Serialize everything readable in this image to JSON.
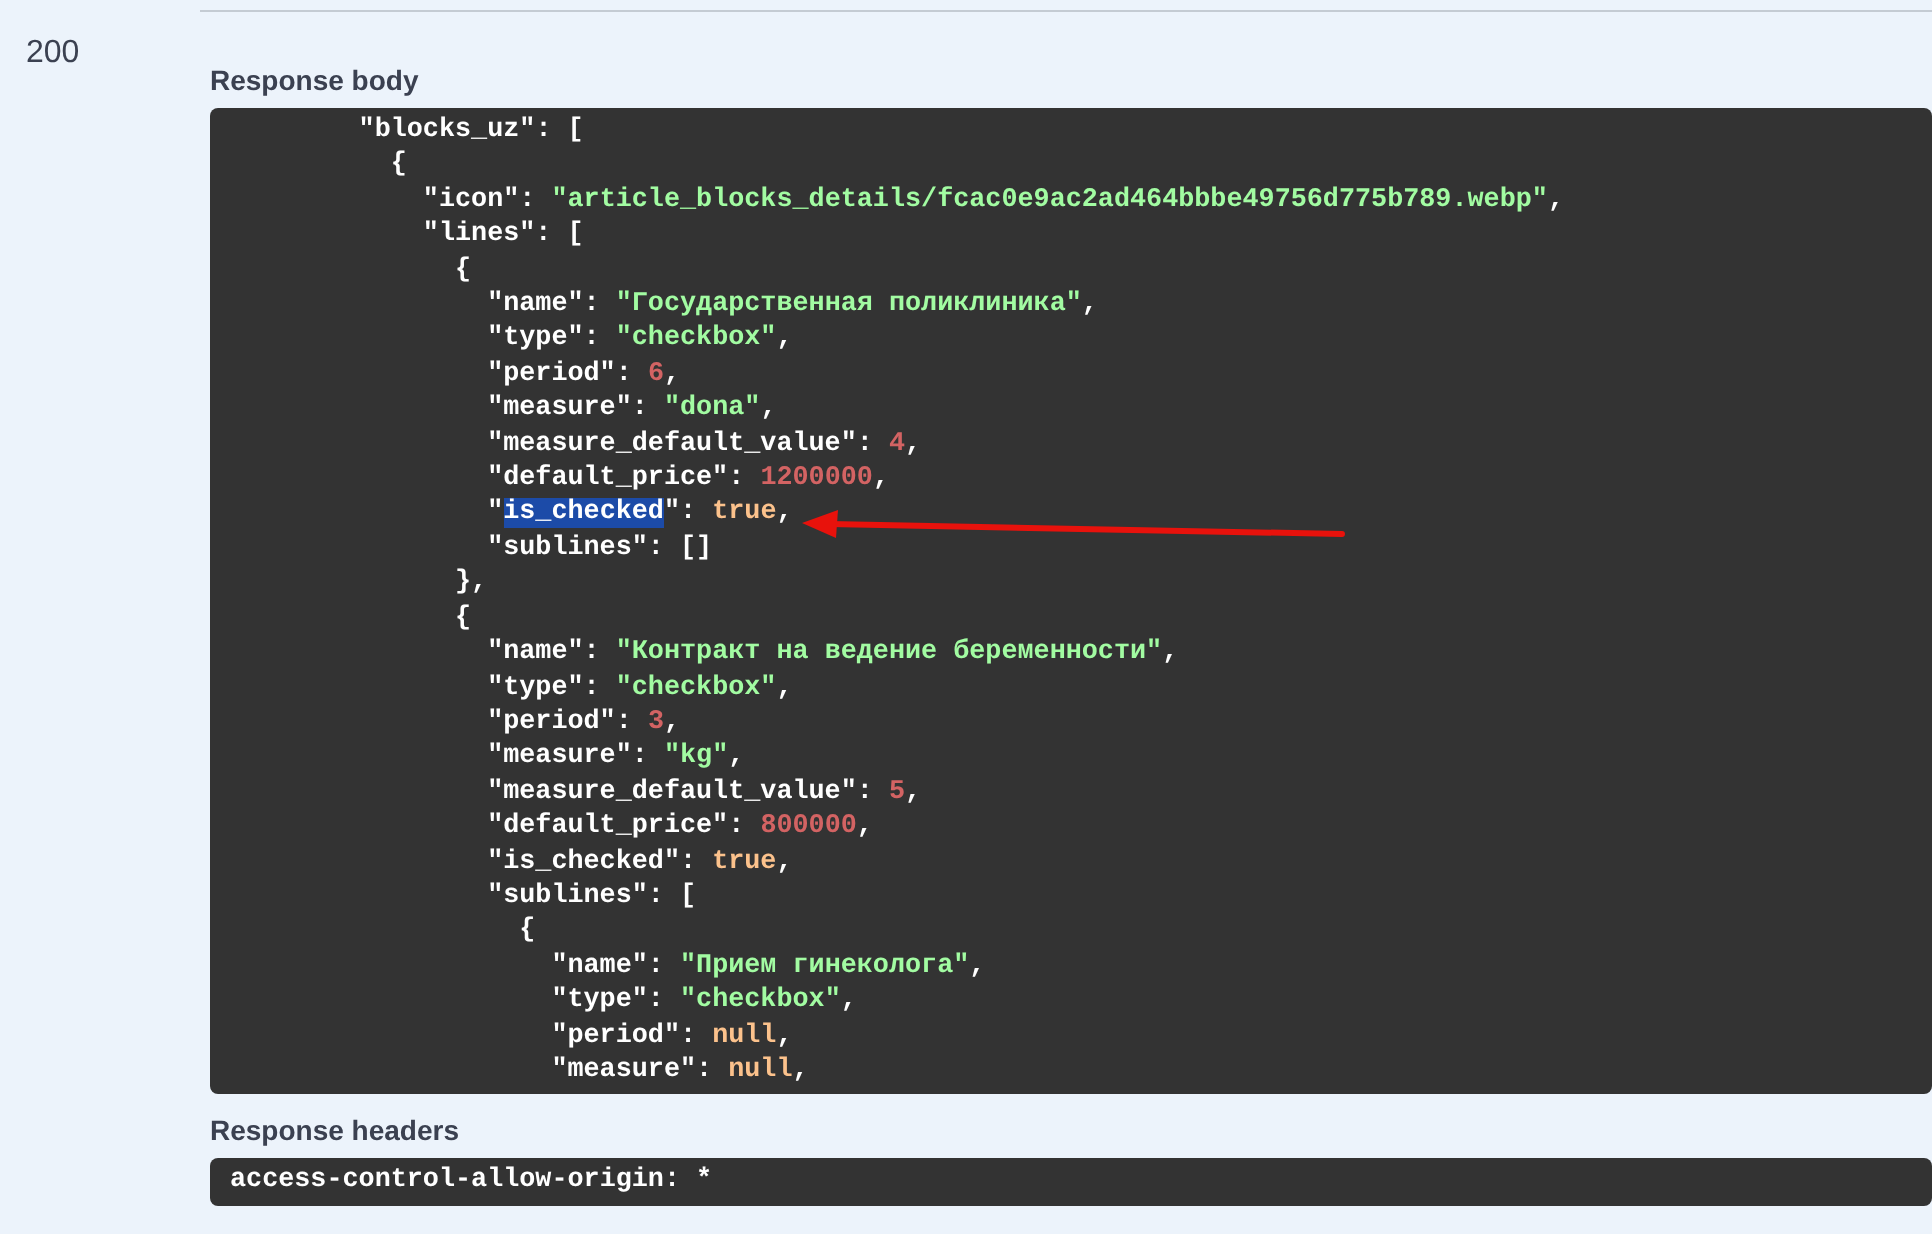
{
  "status_code": "200",
  "response_body": {
    "label": "Response body",
    "lines": [
      {
        "tokens": [
          {
            "kind": "k",
            "text": "\"blocks_uz\""
          },
          {
            "kind": "p",
            "text": ": ["
          }
        ]
      },
      {
        "tokens": [
          {
            "kind": "p",
            "text": "{"
          }
        ]
      },
      {
        "tokens": [
          {
            "kind": "k",
            "text": "\"icon\""
          },
          {
            "kind": "p",
            "text": ": "
          },
          {
            "kind": "s",
            "text": "\"article_blocks_details/fcac0e9ac2ad464bbbe49756d775b789.webp\""
          },
          {
            "kind": "p",
            "text": ","
          }
        ]
      },
      {
        "tokens": [
          {
            "kind": "k",
            "text": "\"lines\""
          },
          {
            "kind": "p",
            "text": ": ["
          }
        ]
      },
      {
        "tokens": [
          {
            "kind": "p",
            "text": "{"
          }
        ]
      },
      {
        "tokens": [
          {
            "kind": "k",
            "text": "\"name\""
          },
          {
            "kind": "p",
            "text": ": "
          },
          {
            "kind": "s",
            "text": "\"Государственная поликлиника\""
          },
          {
            "kind": "p",
            "text": ","
          }
        ]
      },
      {
        "tokens": [
          {
            "kind": "k",
            "text": "\"type\""
          },
          {
            "kind": "p",
            "text": ": "
          },
          {
            "kind": "s",
            "text": "\"checkbox\""
          },
          {
            "kind": "p",
            "text": ","
          }
        ]
      },
      {
        "tokens": [
          {
            "kind": "k",
            "text": "\"period\""
          },
          {
            "kind": "p",
            "text": ": "
          },
          {
            "kind": "n",
            "text": "6"
          },
          {
            "kind": "p",
            "text": ","
          }
        ]
      },
      {
        "tokens": [
          {
            "kind": "k",
            "text": "\"measure\""
          },
          {
            "kind": "p",
            "text": ": "
          },
          {
            "kind": "s",
            "text": "\"dona\""
          },
          {
            "kind": "p",
            "text": ","
          }
        ]
      },
      {
        "tokens": [
          {
            "kind": "k",
            "text": "\"measure_default_value\""
          },
          {
            "kind": "p",
            "text": ": "
          },
          {
            "kind": "n",
            "text": "4"
          },
          {
            "kind": "p",
            "text": ","
          }
        ]
      },
      {
        "tokens": [
          {
            "kind": "k",
            "text": "\"default_price\""
          },
          {
            "kind": "p",
            "text": ": "
          },
          {
            "kind": "n",
            "text": "1200000"
          },
          {
            "kind": "p",
            "text": ","
          }
        ]
      },
      {
        "tokens": [
          {
            "kind": "k",
            "text": "\""
          },
          {
            "kind": "sel",
            "text": "is_checked"
          },
          {
            "kind": "k",
            "text": "\""
          },
          {
            "kind": "p",
            "text": ": "
          },
          {
            "kind": "l",
            "text": "true"
          },
          {
            "kind": "p",
            "text": ","
          }
        ]
      },
      {
        "tokens": [
          {
            "kind": "k",
            "text": "\"sublines\""
          },
          {
            "kind": "p",
            "text": ": []"
          }
        ]
      },
      {
        "tokens": [
          {
            "kind": "p",
            "text": "},"
          }
        ]
      },
      {
        "tokens": [
          {
            "kind": "p",
            "text": "{"
          }
        ]
      },
      {
        "tokens": [
          {
            "kind": "k",
            "text": "\"name\""
          },
          {
            "kind": "p",
            "text": ": "
          },
          {
            "kind": "s",
            "text": "\"Контракт на ведение беременности\""
          },
          {
            "kind": "p",
            "text": ","
          }
        ]
      },
      {
        "tokens": [
          {
            "kind": "k",
            "text": "\"type\""
          },
          {
            "kind": "p",
            "text": ": "
          },
          {
            "kind": "s",
            "text": "\"checkbox\""
          },
          {
            "kind": "p",
            "text": ","
          }
        ]
      },
      {
        "tokens": [
          {
            "kind": "k",
            "text": "\"period\""
          },
          {
            "kind": "p",
            "text": ": "
          },
          {
            "kind": "n",
            "text": "3"
          },
          {
            "kind": "p",
            "text": ","
          }
        ]
      },
      {
        "tokens": [
          {
            "kind": "k",
            "text": "\"measure\""
          },
          {
            "kind": "p",
            "text": ": "
          },
          {
            "kind": "s",
            "text": "\"kg\""
          },
          {
            "kind": "p",
            "text": ","
          }
        ]
      },
      {
        "tokens": [
          {
            "kind": "k",
            "text": "\"measure_default_value\""
          },
          {
            "kind": "p",
            "text": ": "
          },
          {
            "kind": "n",
            "text": "5"
          },
          {
            "kind": "p",
            "text": ","
          }
        ]
      },
      {
        "tokens": [
          {
            "kind": "k",
            "text": "\"default_price\""
          },
          {
            "kind": "p",
            "text": ": "
          },
          {
            "kind": "n",
            "text": "800000"
          },
          {
            "kind": "p",
            "text": ","
          }
        ]
      },
      {
        "tokens": [
          {
            "kind": "k",
            "text": "\"is_checked\""
          },
          {
            "kind": "p",
            "text": ": "
          },
          {
            "kind": "l",
            "text": "true"
          },
          {
            "kind": "p",
            "text": ","
          }
        ]
      },
      {
        "tokens": [
          {
            "kind": "k",
            "text": "\"sublines\""
          },
          {
            "kind": "p",
            "text": ": ["
          }
        ]
      },
      {
        "tokens": [
          {
            "kind": "p",
            "text": "{"
          }
        ]
      },
      {
        "tokens": [
          {
            "kind": "k",
            "text": "\"name\""
          },
          {
            "kind": "p",
            "text": ": "
          },
          {
            "kind": "s",
            "text": "\"Прием гинеколога\""
          },
          {
            "kind": "p",
            "text": ","
          }
        ]
      },
      {
        "tokens": [
          {
            "kind": "k",
            "text": "\"type\""
          },
          {
            "kind": "p",
            "text": ": "
          },
          {
            "kind": "s",
            "text": "\"checkbox\""
          },
          {
            "kind": "p",
            "text": ","
          }
        ]
      },
      {
        "tokens": [
          {
            "kind": "k",
            "text": "\"period\""
          },
          {
            "kind": "p",
            "text": ": "
          },
          {
            "kind": "l",
            "text": "null"
          },
          {
            "kind": "p",
            "text": ","
          }
        ]
      },
      {
        "tokens": [
          {
            "kind": "k",
            "text": "\"measure\""
          },
          {
            "kind": "p",
            "text": ": "
          },
          {
            "kind": "l",
            "text": "null"
          },
          {
            "kind": "p",
            "text": ","
          }
        ]
      }
    ],
    "annotations": [
      {
        "kind": "arrow"
      }
    ]
  },
  "response_headers": {
    "label": "Response headers",
    "lines": [
      {
        "tokens": [
          {
            "kind": "h",
            "text": "access-control-allow-origin: *"
          }
        ]
      }
    ]
  }
}
